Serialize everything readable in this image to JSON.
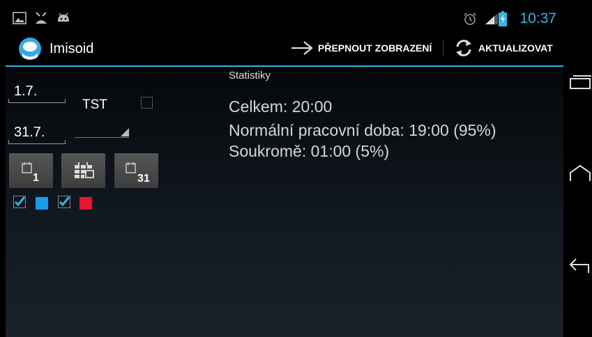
{
  "status_bar": {
    "time": "10:37",
    "left_icons": [
      "gallery-icon",
      "alert-icon",
      "android-icon"
    ],
    "right_icons": [
      "alarm-icon",
      "signal-icon",
      "battery-icon"
    ]
  },
  "action_bar": {
    "app_title": "Imisoid",
    "switch_view_label": "PŘEPNOUT ZOBRAZENÍ",
    "refresh_label": "AKTUALIZOVAT"
  },
  "filters": {
    "date_from": "1.7.",
    "date_to": "31.7.",
    "tst_label": "TST",
    "tst_checked": false
  },
  "quick_buttons": [
    {
      "icon": "calendar-day-icon",
      "number": "1"
    },
    {
      "icon": "calendar-month-icon",
      "number": ""
    },
    {
      "icon": "calendar-day-icon",
      "number": "31"
    }
  ],
  "legend": [
    {
      "checked": true,
      "color": "#1a9be8"
    },
    {
      "checked": true,
      "color": "#e3182e"
    }
  ],
  "stats": {
    "title": "Statistiky",
    "total": "Celkem: 20:00",
    "normal": "Normální pracovní doba: 19:00 (95%)",
    "private": "Soukromě: 01:00 (5%)"
  },
  "colors": {
    "accent": "#33b5e5"
  }
}
